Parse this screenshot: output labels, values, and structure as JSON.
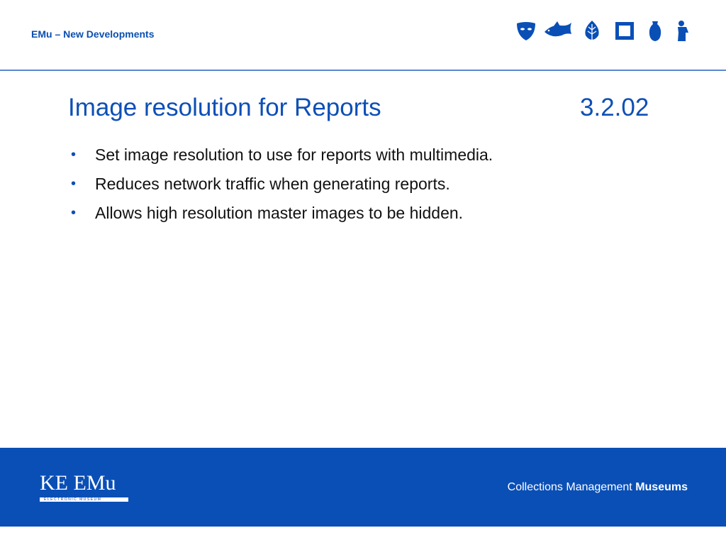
{
  "header": {
    "title": "EMu – New Developments",
    "icons": [
      "mask-icon",
      "fish-icon",
      "leaf-icon",
      "frame-icon",
      "vase-icon",
      "statue-icon"
    ]
  },
  "slide": {
    "title": "Image resolution for Reports",
    "number": "3.2.02",
    "bullets": [
      "Set image resolution to use for reports with multimedia.",
      "Reduces network traffic when generating reports.",
      "Allows high resolution master images to be hidden."
    ],
    "bullet_symbol": "•"
  },
  "footer": {
    "logo_text": "KE EMu",
    "logo_subtext": "ELECTRONIC MUSEUM",
    "tagline_regular": "Collections Management",
    "tagline_bold": "Museums"
  },
  "colors": {
    "brand_blue": "#0a4fb6",
    "title_blue": "#0d4fb6",
    "rule_blue": "#5a87d2"
  }
}
